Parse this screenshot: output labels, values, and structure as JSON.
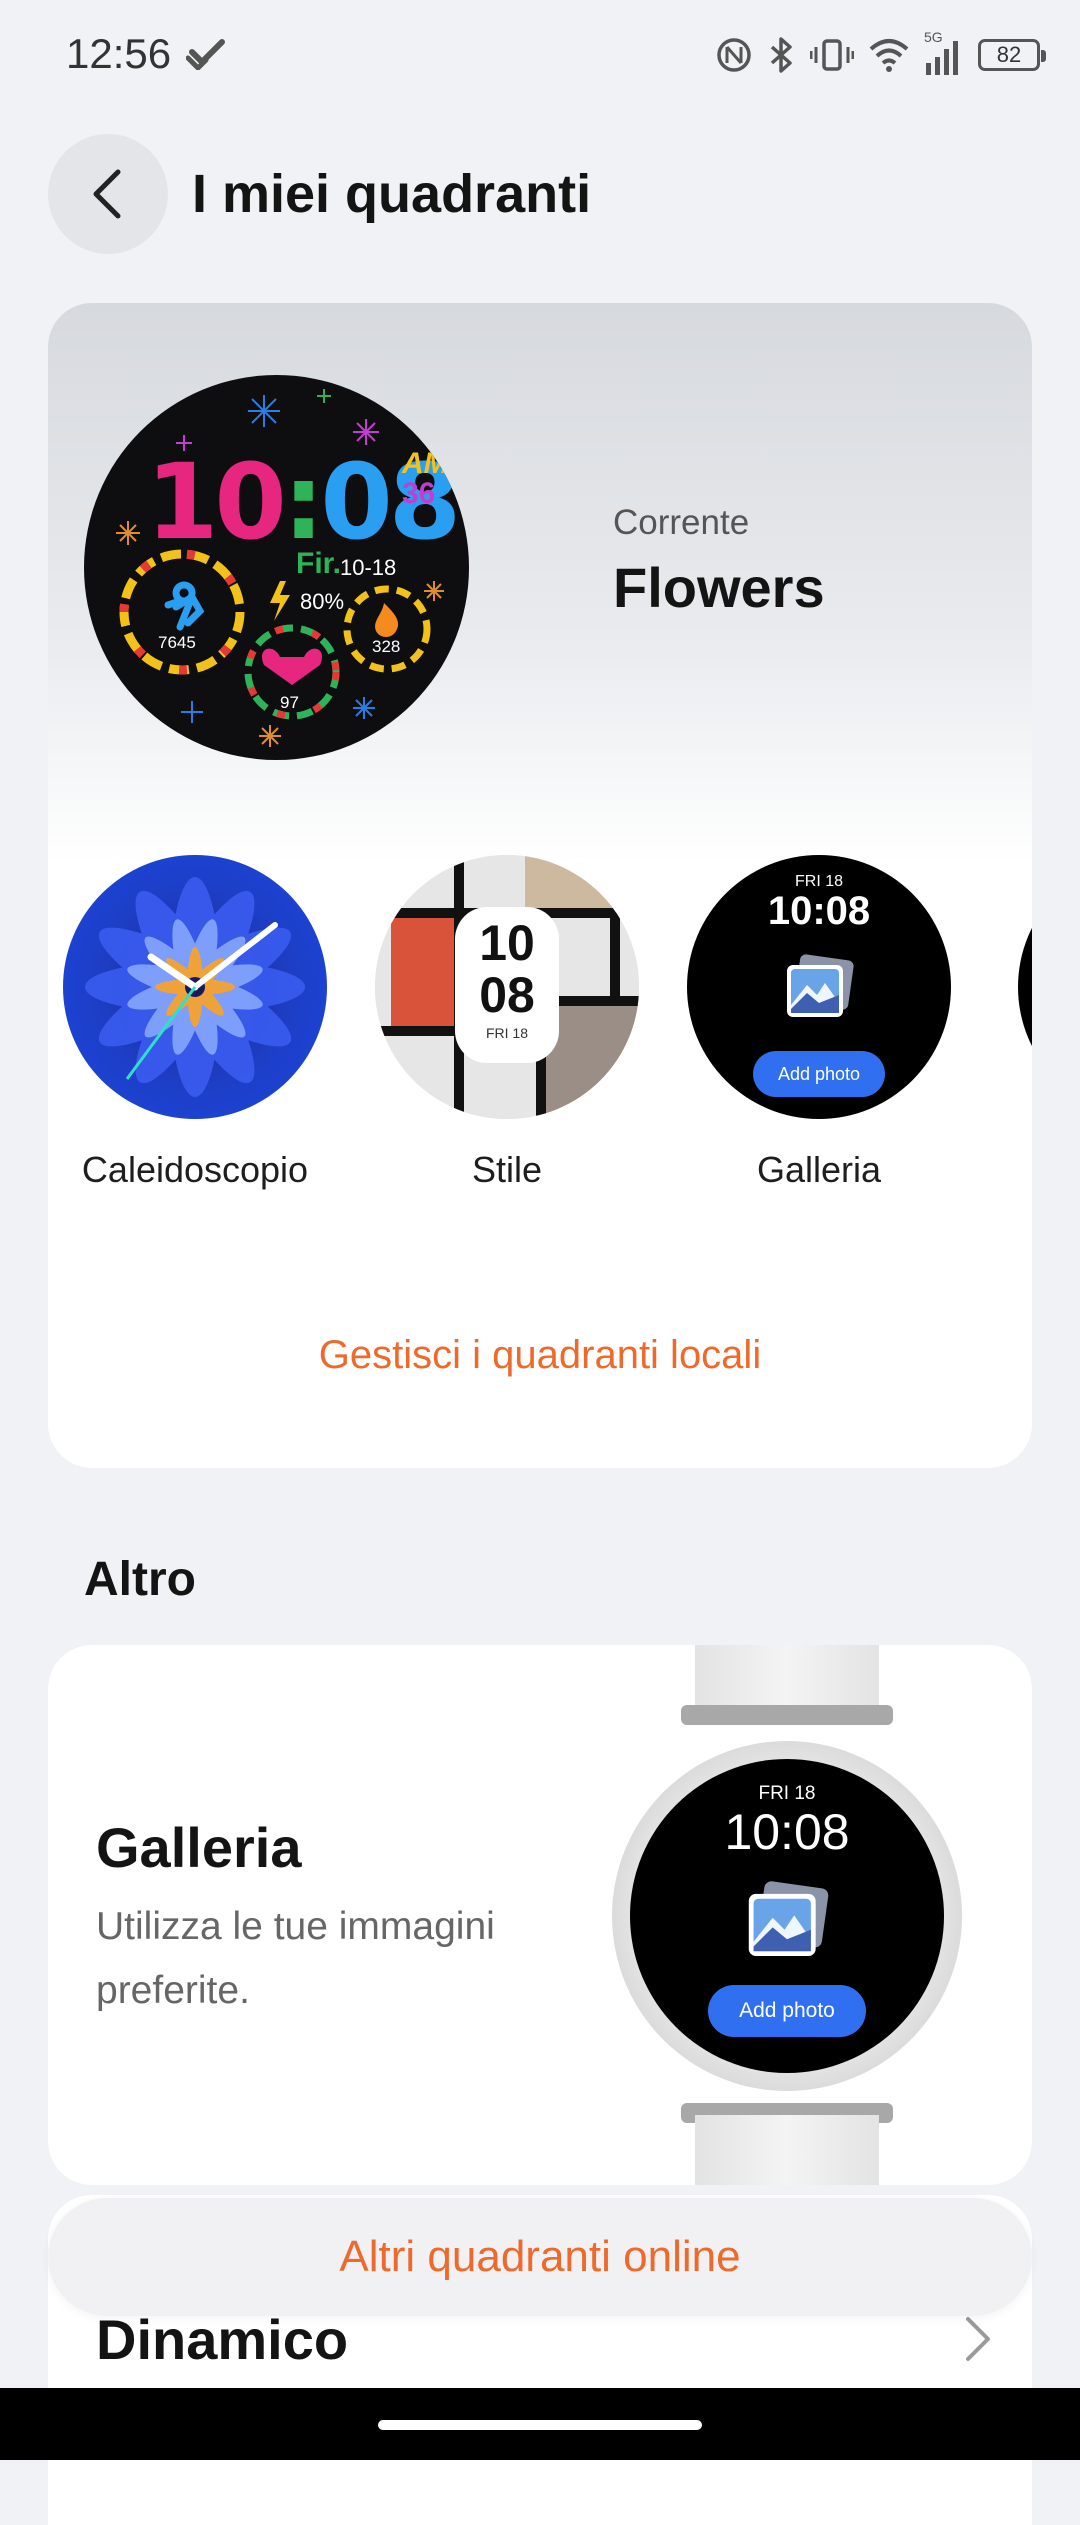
{
  "status_bar": {
    "time": "12:56",
    "network": "5G",
    "battery": "82"
  },
  "header": {
    "title": "I miei quadranti"
  },
  "current": {
    "label": "Corrente",
    "name": "Flowers",
    "preview": {
      "hour": "10",
      "minute": "08",
      "ampm": "AM",
      "seconds": "36",
      "day": "Fir.",
      "date": "10-18",
      "battery": "80%",
      "steps": "7645",
      "heart": "97",
      "calories": "328"
    }
  },
  "faces": [
    {
      "label": "Caleidoscopio"
    },
    {
      "label": "Stile",
      "time_top": "10",
      "time_bottom": "08",
      "date": "FRI 18"
    },
    {
      "label": "Galleria",
      "date": "FRI 18",
      "time": "10:08",
      "button": "Add photo"
    }
  ],
  "manage_link": "Gestisci i quadranti locali",
  "section": {
    "title": "Altro"
  },
  "gallery_card": {
    "title": "Galleria",
    "description": "Utilizza le tue immagini preferite.",
    "watch": {
      "date": "FRI 18",
      "time": "10:08",
      "button": "Add photo"
    }
  },
  "dynamic_card": {
    "title": "Dinamico"
  },
  "online_button": "Altri quadranti online",
  "colors": {
    "accent": "#ee6a2c",
    "background": "#f1f2f5",
    "photo_button": "#2f6ff0"
  }
}
